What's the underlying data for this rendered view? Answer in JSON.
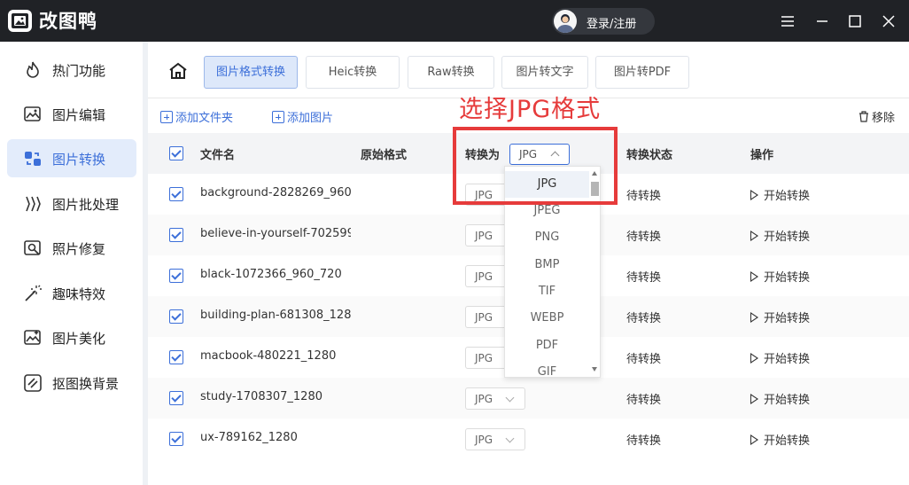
{
  "app": {
    "name": "改图鸭",
    "login": "登录/注册"
  },
  "sidebar": {
    "items": [
      {
        "label": "热门功能",
        "icon": "flame-icon"
      },
      {
        "label": "图片编辑",
        "icon": "image-edit-icon"
      },
      {
        "label": "图片转换",
        "icon": "convert-icon",
        "active": true
      },
      {
        "label": "图片批处理",
        "icon": "batch-icon"
      },
      {
        "label": "照片修复",
        "icon": "photo-repair-icon"
      },
      {
        "label": "趣味特效",
        "icon": "magic-icon"
      },
      {
        "label": "图片美化",
        "icon": "beautify-icon"
      },
      {
        "label": "抠图换背景",
        "icon": "cutout-icon"
      }
    ]
  },
  "tabs": [
    "图片格式转换",
    "Heic转换",
    "Raw转换",
    "图片转文字",
    "图片转PDF"
  ],
  "toolbar": {
    "add_folder": "添加文件夹",
    "add_image": "添加图片",
    "remove": "移除"
  },
  "table": {
    "headers": {
      "name": "文件名",
      "orig_format": "原始格式",
      "convert_to": "转换为",
      "status": "转换状态",
      "action": "操作"
    },
    "header_format": "JPG",
    "rows": [
      {
        "name": "background-2828269_960_...",
        "format": "JPG",
        "status": "待转换",
        "action": "开始转换"
      },
      {
        "name": "believe-in-yourself-702599...",
        "format": "JPG",
        "status": "待转换",
        "action": "开始转换"
      },
      {
        "name": "black-1072366_960_720",
        "format": "JPG",
        "status": "待转换",
        "action": "开始转换"
      },
      {
        "name": "building-plan-681308_1280",
        "format": "JPG",
        "status": "待转换",
        "action": "开始转换"
      },
      {
        "name": "macbook-480221_1280",
        "format": "JPG",
        "status": "待转换",
        "action": "开始转换"
      },
      {
        "name": "study-1708307_1280",
        "format": "JPG",
        "status": "待转换",
        "action": "开始转换"
      },
      {
        "name": "ux-789162_1280",
        "format": "JPG",
        "status": "待转换",
        "action": "开始转换"
      }
    ]
  },
  "dropdown": {
    "options": [
      "JPG",
      "JPEG",
      "PNG",
      "BMP",
      "TIF",
      "WEBP",
      "PDF",
      "GIF"
    ],
    "selected": "JPG"
  },
  "annotation": {
    "text": "选择JPG格式",
    "color": "#e63b3b"
  },
  "colors": {
    "accent": "#3c6fd9",
    "titlebar": "#202226"
  }
}
